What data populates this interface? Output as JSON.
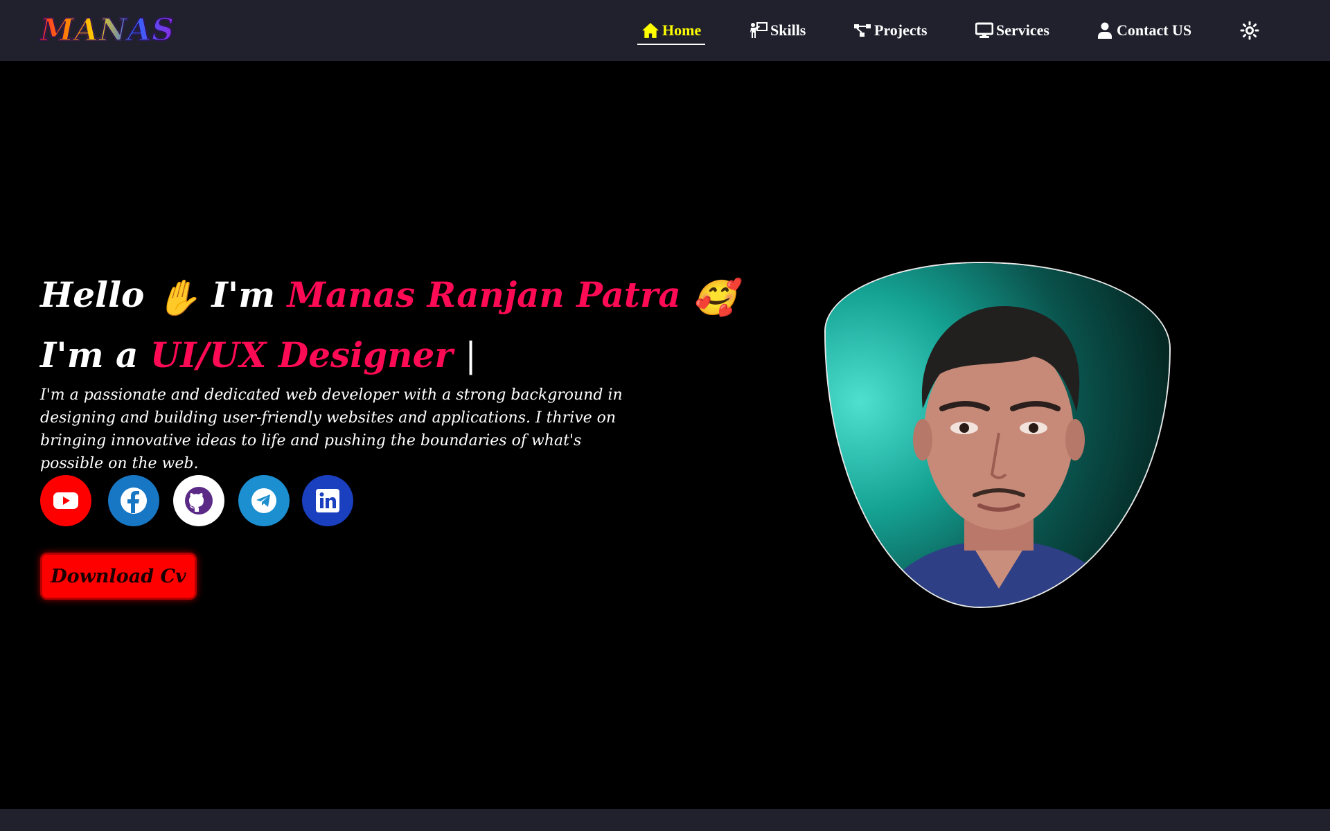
{
  "brand": {
    "logo_text": "MANAS"
  },
  "nav": {
    "items": [
      {
        "label": "Home",
        "icon": "home-icon",
        "active": true
      },
      {
        "label": "Skills",
        "icon": "presenter-icon"
      },
      {
        "label": "Projects",
        "icon": "diagram-icon"
      },
      {
        "label": "Services",
        "icon": "desktop-icon"
      },
      {
        "label": "Contact US",
        "icon": "user-icon"
      }
    ],
    "theme_toggle_icon": "sun-icon",
    "active_color": "#ffff00"
  },
  "hero": {
    "greeting": "Hello",
    "greeting_emoji": "✋",
    "intro": "I'm",
    "name": "Manas Ranjan Patra",
    "name_emoji": "🥰",
    "role_prefix": "I'm a",
    "role": "UI/UX Designer",
    "cursor": "|",
    "bio": "I'm a passionate and dedicated web developer with a strong background in designing and building user-friendly websites and applications. I thrive on bringing innovative ideas to life and pushing the boundaries of what's possible on the web.",
    "accent_color": "#ff0a54"
  },
  "socials": [
    {
      "name": "youtube",
      "icon": "youtube-icon",
      "bg": "#ff0000"
    },
    {
      "name": "facebook",
      "icon": "facebook-icon",
      "bg": "#1877c4"
    },
    {
      "name": "github",
      "icon": "github-icon",
      "bg": "#ffffff"
    },
    {
      "name": "telegram",
      "icon": "telegram-icon",
      "bg": "#1b8fd0"
    },
    {
      "name": "linkedin",
      "icon": "linkedin-icon",
      "bg": "#1a3fbf"
    }
  ],
  "cta": {
    "download_cv": "Download Cv",
    "color": "#ff0000"
  },
  "profile": {
    "photo_icon": "profile-photo"
  }
}
